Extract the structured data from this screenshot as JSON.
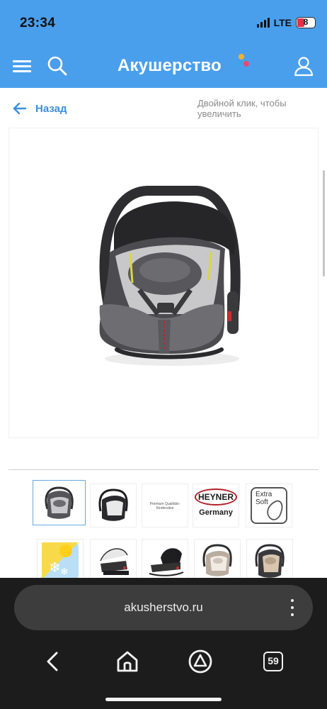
{
  "status_bar": {
    "time": "23:34",
    "network": "LTE",
    "battery_level": "8"
  },
  "header": {
    "logo_text": "Акушерство",
    "brand_color": "#4a9fec",
    "logo_dot_colors": [
      "#f6b12c",
      "#3aa6ea",
      "#e84a6a"
    ]
  },
  "nav": {
    "back_label": "Назад",
    "zoom_hint": "Двойной клик, чтобы увеличить"
  },
  "product": {
    "main_image": "infant-car-seat-grey",
    "thumbnails": [
      {
        "name": "car-seat-grey",
        "selected": true
      },
      {
        "name": "car-seat-black",
        "selected": false
      },
      {
        "name": "premium-label",
        "selected": false,
        "text": "Premium Qualitäts-Kindersitze"
      },
      {
        "name": "heyner-logo",
        "selected": false,
        "brand": "HEYNER",
        "country": "Germany"
      },
      {
        "name": "extra-soft-badge",
        "selected": false,
        "line1": "Extra",
        "line2": "Soft"
      },
      {
        "name": "season-icon",
        "selected": false
      },
      {
        "name": "car-seat-with-base",
        "selected": false
      },
      {
        "name": "car-seat-rocker-black",
        "selected": false
      },
      {
        "name": "car-seat-beige",
        "selected": false
      },
      {
        "name": "car-seat-beige-front",
        "selected": false
      }
    ]
  },
  "browser": {
    "url": "akusherstvo.ru",
    "tabs_count": "59"
  }
}
